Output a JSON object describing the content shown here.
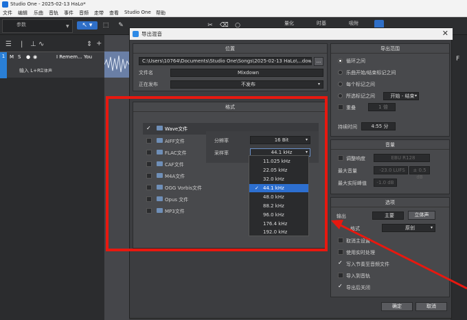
{
  "window": {
    "title": "Studio One - 2025-02-13 HaLo*"
  },
  "menu": [
    "文件",
    "编辑",
    "乐曲",
    "音轨",
    "事件",
    "音频",
    "走带",
    "查看",
    "Studio One",
    "帮助"
  ],
  "toolbar": {
    "param_label": "参数",
    "quantize_label": "量化",
    "timebase_label": "时基",
    "snap_label": "吸附"
  },
  "track": {
    "number": "1",
    "name": "I Remem... You",
    "m": "M",
    "s": "S",
    "input": "输入 L+R",
    "mode": "立体声"
  },
  "dialog": {
    "title": "导出混音",
    "location": {
      "title": "位置",
      "path": "C:\\Users\\10764\\Documents\\Studio One\\Songs\\2025-02-13 HaLo\\...down",
      "browse": "...",
      "filename_label": "文件名",
      "filename": "Mixdown",
      "publish_label": "正在发布",
      "publish_value": "不发布"
    },
    "format": {
      "title": "格式",
      "items": [
        {
          "label": "Wave文件",
          "checked": true
        },
        {
          "label": "AIFF文件",
          "checked": false
        },
        {
          "label": "FLAC文件",
          "checked": false
        },
        {
          "label": "CAF文件",
          "checked": false
        },
        {
          "label": "M4A文件",
          "checked": false
        },
        {
          "label": "OGG Vorbis文件",
          "checked": false
        },
        {
          "label": "Opus 文件",
          "checked": false
        },
        {
          "label": "MP3文件",
          "checked": false
        }
      ],
      "resolution_label": "分辨率",
      "resolution_value": "16 Bit",
      "samplerate_label": "采样率",
      "samplerate_value": "44.1 kHz",
      "samplerate_options": [
        "11.025 kHz",
        "22.05 kHz",
        "32.0 kHz",
        "44.1 kHz",
        "48.0 kHz",
        "88.2 kHz",
        "96.0 kHz",
        "176.4 kHz",
        "192.0 kHz"
      ],
      "samplerate_selected": "44.1 kHz"
    },
    "export_range": {
      "title": "导出范围",
      "options": [
        "循环之间",
        "乐曲开始/结束标记之间",
        "每个标记之间",
        "所选标记之间"
      ],
      "selected": "循环之间",
      "marker_select": "开始 - 结束",
      "repeat_label": "重叠",
      "repeat_value": "1 倍",
      "duration_label": "持续时间",
      "duration_value": "4:55 分"
    },
    "loudness": {
      "title": "音量",
      "adjust_label": "调整响度",
      "adjust_value": "EBU R128",
      "max_loudness_label": "最大音量",
      "max_loudness_value": "-23.0 LUFS",
      "max_loudness_tol": "± 0.5 dB",
      "max_peak_label": "最大实际峰值",
      "max_peak_value": "-1.0 dB"
    },
    "options": {
      "title": "选项",
      "output_label": "输出",
      "output_value": "主要",
      "output_mode": "立体声",
      "format_label": "格式",
      "format_value": "原创",
      "checks": [
        {
          "label": "取消主设置",
          "checked": false
        },
        {
          "label": "使用实时处理",
          "checked": false
        },
        {
          "label": "写入节奏至音频文件",
          "checked": true
        },
        {
          "label": "导入到音轨",
          "checked": false
        },
        {
          "label": "导出后关闭",
          "checked": true
        }
      ]
    },
    "ok": "确定",
    "cancel": "取消"
  },
  "colors": {
    "accent": "#2d6fd0",
    "annotation": "#e8180f"
  }
}
